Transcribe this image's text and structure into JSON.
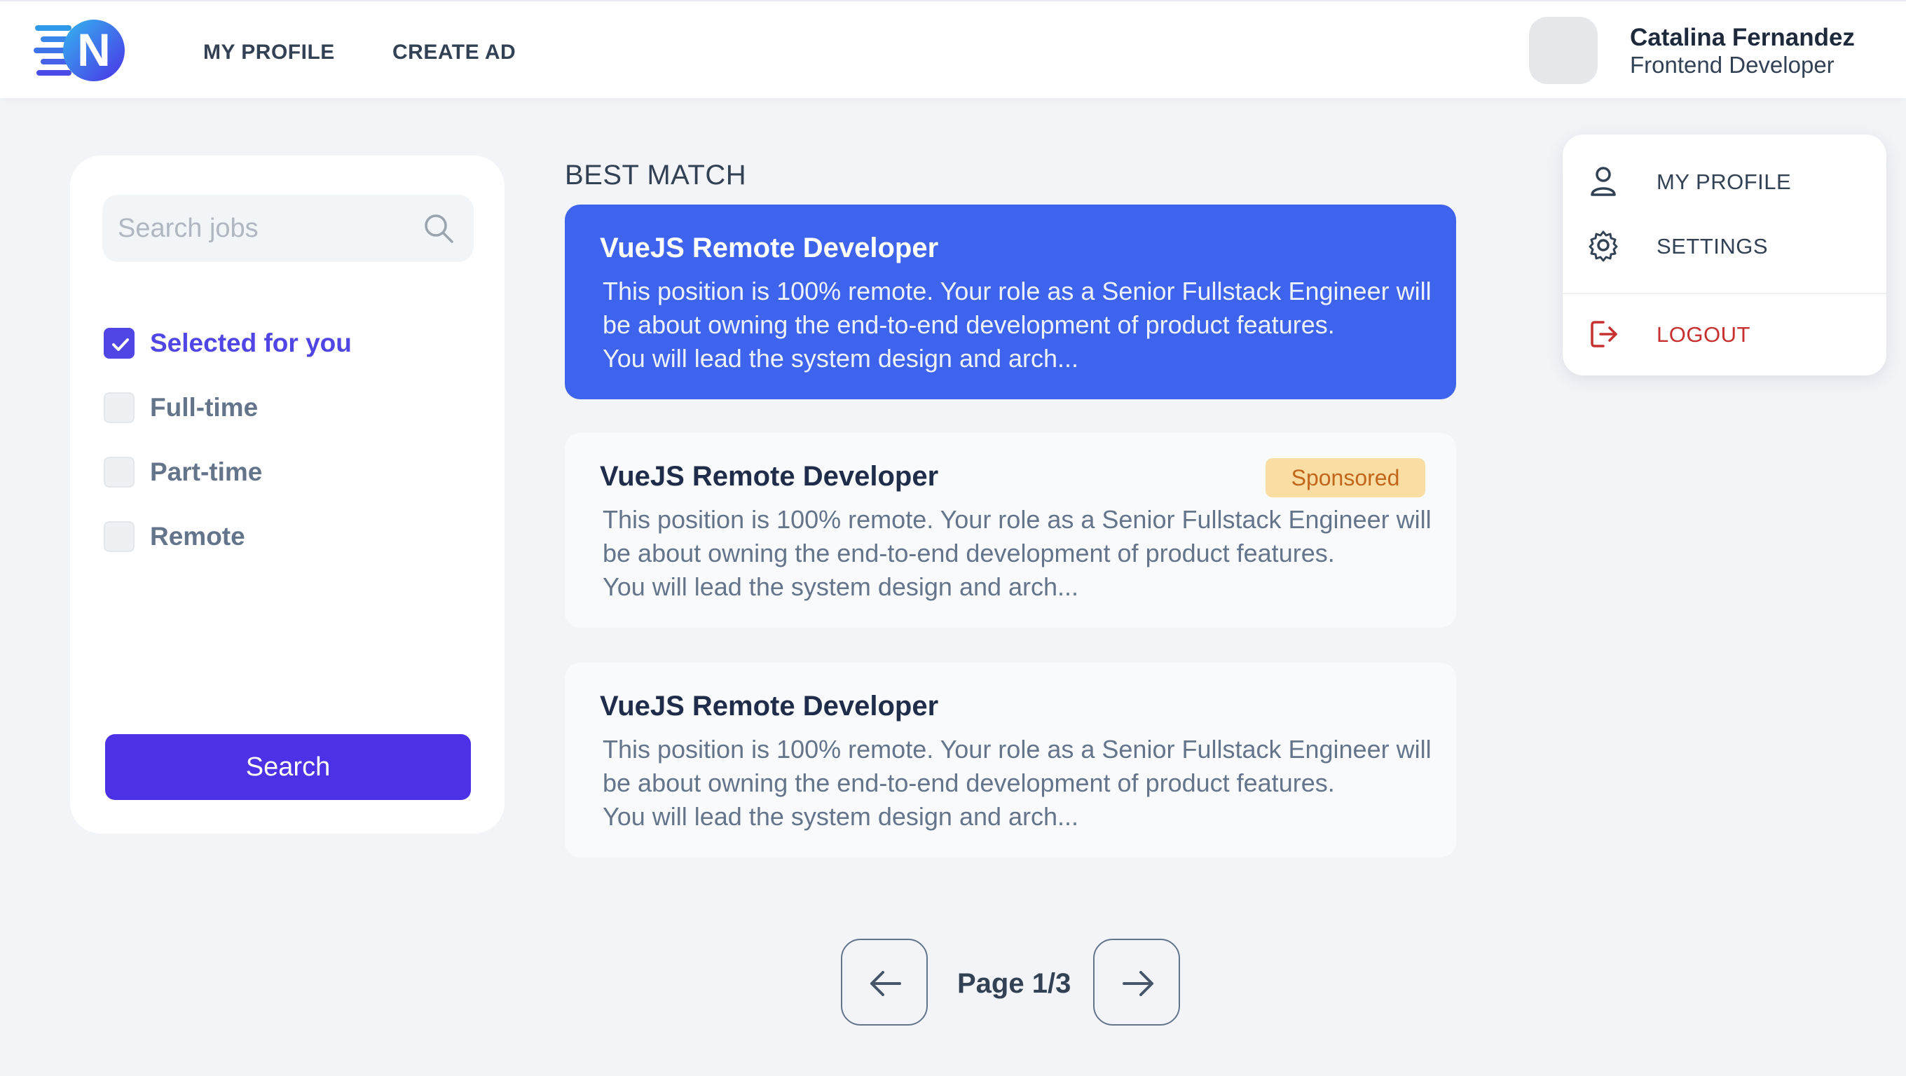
{
  "header": {
    "logo_letter": "N",
    "nav": [
      {
        "label": "MY PROFILE"
      },
      {
        "label": "CREATE AD"
      }
    ],
    "user": {
      "name": "Catalina Fernandez",
      "role": "Frontend Developer"
    }
  },
  "filters": {
    "search_placeholder": "Search jobs",
    "search_value": "",
    "options": [
      {
        "label": "Selected for you",
        "checked": true
      },
      {
        "label": "Full-time",
        "checked": false
      },
      {
        "label": "Part-time",
        "checked": false
      },
      {
        "label": "Remote",
        "checked": false
      }
    ],
    "search_button": "Search"
  },
  "main": {
    "section_title": "BEST MATCH",
    "jobs": [
      {
        "title": "VueJS Remote Developer",
        "description": "This position is 100% remote. Your role as a Senior Fullstack Engineer will be about owning the end-to-end development of product features.\n You will lead the system design and arch...",
        "active": true
      },
      {
        "title": "VueJS Remote Developer",
        "badge": "Sponsored",
        "description": "This position is 100% remote. Your role as a Senior Fullstack Engineer will be about owning the end-to-end development of product features.\n You will lead the system design and arch...",
        "active": false
      },
      {
        "title": "VueJS Remote Developer",
        "description": "This position is 100% remote. Your role as a Senior Fullstack Engineer will be about owning the end-to-end development of product features.\n You will lead the system design and arch...",
        "active": false
      }
    ],
    "pagination": {
      "label": "Page 1/3",
      "prev_icon": "arrow-left-icon",
      "next_icon": "arrow-right-icon"
    }
  },
  "dropdown": {
    "items": [
      {
        "label": "MY PROFILE",
        "icon": "user-icon"
      },
      {
        "label": "SETTINGS",
        "icon": "gear-icon"
      },
      {
        "label": "LOGOUT",
        "icon": "logout-icon"
      }
    ]
  },
  "colors": {
    "primary": "#4b32e6",
    "active_card": "#3e63ec",
    "sponsored_bg": "#f9dda3",
    "sponsored_text": "#c2661b",
    "logout": "#c6302f"
  }
}
